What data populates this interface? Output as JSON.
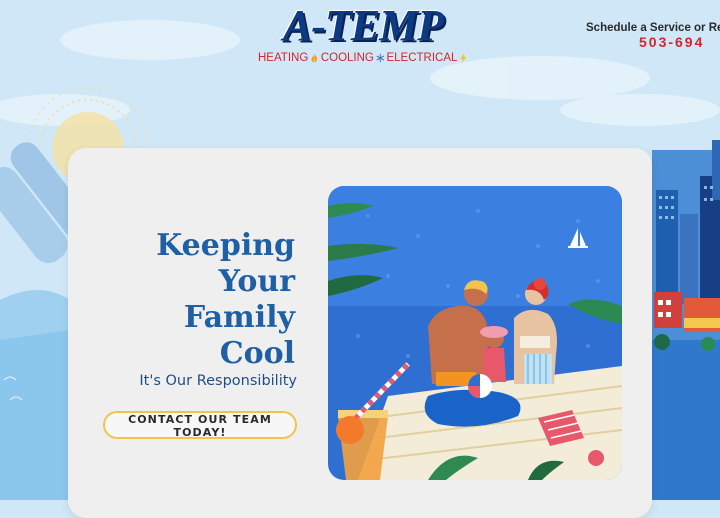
{
  "header": {
    "logo": {
      "wordmark": "A-TEMP",
      "tagline": {
        "heating": "HEATING",
        "cooling": "COOLING",
        "electrical": "ELECTRICAL"
      }
    },
    "schedule_text": "Schedule a Service or Rep",
    "phone": "503-694"
  },
  "hero": {
    "headline_lines": [
      "Keeping",
      "Your",
      "Family",
      "Cool"
    ],
    "subheadline": "It's Our Responsibility",
    "cta_label": "CONTACT OUR TEAM TODAY!"
  },
  "icons": {
    "flame": "flame-icon",
    "snowflake": "snowflake-icon",
    "bolt": "lightning-bolt-icon",
    "sailboat": "sailboat-icon"
  },
  "colors": {
    "brand_blue": "#0d3a84",
    "brand_red": "#d4252c",
    "headline_blue": "#1f5fa3",
    "cta_border": "#f1c54b",
    "card_bg": "#efefef",
    "page_bg": "#cfe7f6"
  }
}
